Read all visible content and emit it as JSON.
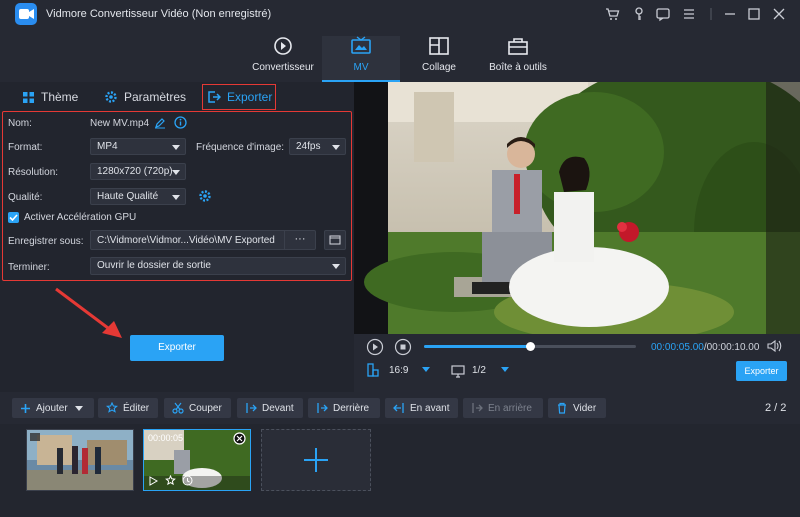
{
  "window": {
    "title": "Vidmore Convertisseur Vidéo (Non enregistré)"
  },
  "nav": [
    {
      "label": "Convertisseur"
    },
    {
      "label": "MV"
    },
    {
      "label": "Collage"
    },
    {
      "label": "Boîte à outils"
    }
  ],
  "tabs": {
    "theme": "Thème",
    "params": "Paramètres",
    "export": "Exporter"
  },
  "form": {
    "name_label": "Nom:",
    "name_value": "New MV.mp4",
    "format_label": "Format:",
    "format_value": "MP4",
    "fps_label": "Fréquence d'image:",
    "fps_value": "24fps",
    "res_label": "Résolution:",
    "res_value": "1280x720 (720p)",
    "quality_label": "Qualité:",
    "quality_value": "Haute Qualité",
    "gpu_label": "Activer Accélération GPU",
    "save_label": "Enregistrer sous:",
    "save_path": "C:\\Vidmore\\Vidmor...Vidéo\\MV Exported",
    "browse_dots": "···",
    "finish_label": "Terminer:",
    "finish_value": "Ouvrir le dossier de sortie"
  },
  "export_button": "Exporter",
  "player": {
    "current_time": "00:00:05.00",
    "total_time": "/00:00:10.00",
    "progress": 0.5,
    "ratio": "16:9",
    "page": "1/2",
    "export_label": "Exporter"
  },
  "toolbar": {
    "add": "Ajouter",
    "edit": "Éditer",
    "cut": "Couper",
    "front": "Devant",
    "behind": "Derrière",
    "forward": "En avant",
    "backward": "En arrière",
    "clear": "Vider",
    "count": "2 / 2"
  },
  "timeline": {
    "clip2_time": "00:00:05"
  },
  "colors": {
    "accent": "#2aa3f5",
    "highlight": "#e53935"
  }
}
